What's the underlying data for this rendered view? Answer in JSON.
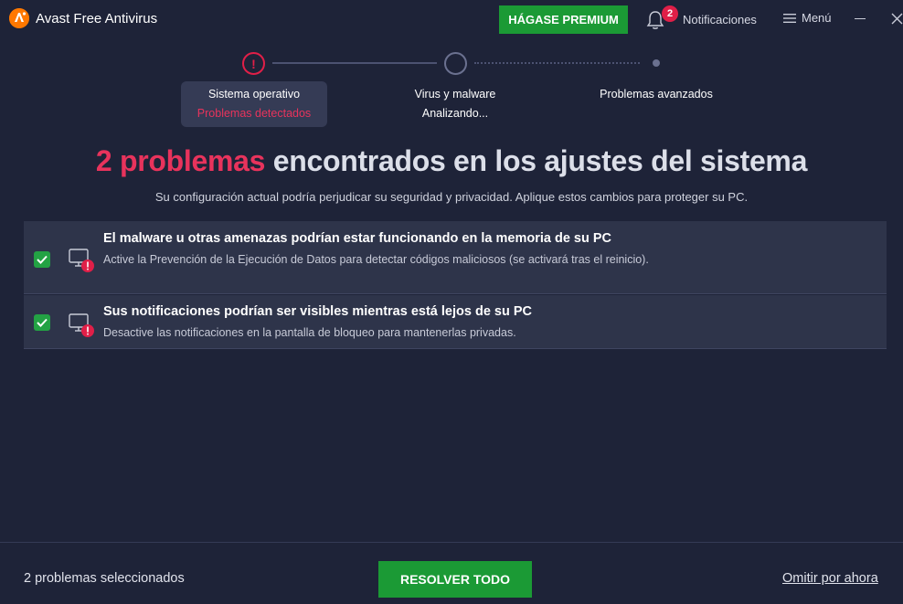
{
  "app": {
    "title": "Avast Free Antivirus",
    "brand_color": "#ff7800"
  },
  "header": {
    "premium_label": "HÁGASE PREMIUM",
    "notifications_label": "Notificaciones",
    "notifications_count": "2",
    "menu_label": "Menú"
  },
  "stepper": {
    "steps": [
      {
        "title": "Sistema operativo",
        "status": "Problemas detectados",
        "state": "active"
      },
      {
        "title": "Virus y malware",
        "status": "Analizando...",
        "state": "scanning"
      },
      {
        "title": "Problemas avanzados",
        "status": "",
        "state": "pending"
      }
    ],
    "active_icon": "!"
  },
  "headline": {
    "count": "2 problemas",
    "rest": "encontrados en los ajustes del sistema",
    "subtitle": "Su configuración actual podría perjudicar su seguridad y privacidad. Aplique estos cambios para proteger su PC."
  },
  "issues": [
    {
      "checked": true,
      "title": "El malware u otras amenazas podrían estar funcionando en la memoria de su PC",
      "description": "Active la Prevención de la Ejecución de Datos para detectar códigos maliciosos (se activará tras el reinicio)."
    },
    {
      "checked": true,
      "title": "Sus notificaciones podrían ser visibles mientras está lejos de su PC",
      "description": "Desactive las notificaciones en la pantalla de bloqueo para mantenerlas privadas."
    }
  ],
  "footer": {
    "selected_count": "2 problemas seleccionados",
    "resolve_label": "RESOLVER TODO",
    "skip_label": "Omitir por ahora"
  },
  "colors": {
    "background": "#1e2338",
    "accent_red": "#e8335c",
    "accent_green": "#1b9a35",
    "card": "#2e344a"
  }
}
